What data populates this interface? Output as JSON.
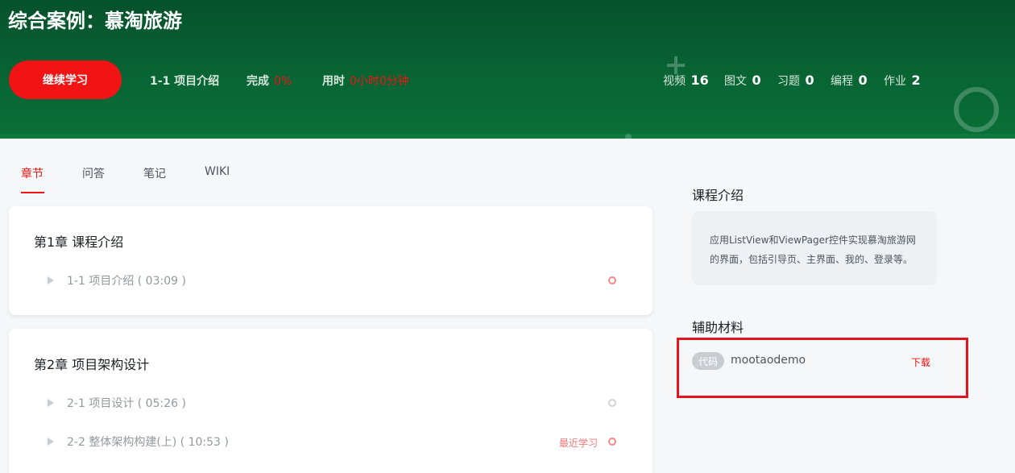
{
  "header": {
    "title": "综合案例：慕淘旅游",
    "continue_label": "继续学习",
    "current_lesson": "1-1 项目介绍",
    "progress_label": "完成",
    "progress_value": "0%",
    "time_label": "用时",
    "time_value": "0小时0分钟",
    "counts": [
      {
        "label": "视频",
        "value": "16"
      },
      {
        "label": "图文",
        "value": "0"
      },
      {
        "label": "习题",
        "value": "0"
      },
      {
        "label": "编程",
        "value": "0"
      },
      {
        "label": "作业",
        "value": "2"
      }
    ]
  },
  "tabs": [
    "章节",
    "问答",
    "笔记",
    "WIKI"
  ],
  "chapters": [
    {
      "title": "第1章 课程介绍",
      "lessons": [
        {
          "title": "1-1 项目介绍 ( 03:09 )",
          "recent": ""
        }
      ]
    },
    {
      "title": "第2章 项目架构设计",
      "lessons": [
        {
          "title": "2-1 项目设计 ( 05:26 )",
          "recent": ""
        },
        {
          "title": "2-2 整体架构构建(上) ( 10:53 )",
          "recent": "最近学习"
        }
      ]
    }
  ],
  "sidebar": {
    "intro_heading": "课程介绍",
    "intro_text_line1": "应用ListView和ViewPager控件实现慕淘旅游网",
    "intro_text_line2": "的界面，包括引导页、主界面、我的、登录等。",
    "materials_heading": "辅助材料",
    "material": {
      "tag": "代码",
      "name": "mootaodemo",
      "download": "下载"
    }
  },
  "colors": {
    "accent": "#f01414",
    "banner": "#086634"
  }
}
